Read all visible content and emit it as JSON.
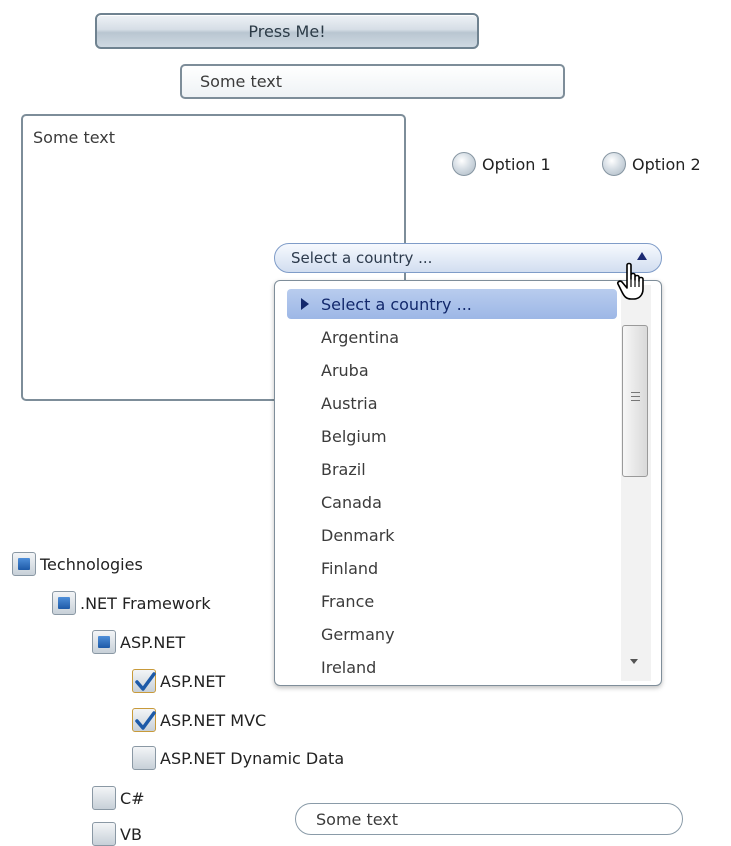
{
  "button": {
    "label": "Press Me!"
  },
  "textbox_top": {
    "value": "Some text"
  },
  "textarea": {
    "value": "Some text"
  },
  "radios": [
    {
      "label": "Option 1"
    },
    {
      "label": "Option 2"
    }
  ],
  "combo": {
    "selected": "Select a country ...",
    "items": [
      "Select a country ...",
      "Argentina",
      "Aruba",
      "Austria",
      "Belgium",
      "Brazil",
      "Canada",
      "Denmark",
      "Finland",
      "France",
      "Germany",
      "Ireland"
    ]
  },
  "tree": {
    "root": "Technologies",
    "net_framework": ".NET Framework",
    "aspnet_group": "ASP.NET",
    "aspnet": "ASP.NET",
    "aspnet_mvc": "ASP.NET MVC",
    "aspnet_dynamic": "ASP.NET Dynamic Data",
    "csharp": "C#",
    "vb": "VB"
  },
  "textbox_bottom": {
    "value": "Some text"
  }
}
